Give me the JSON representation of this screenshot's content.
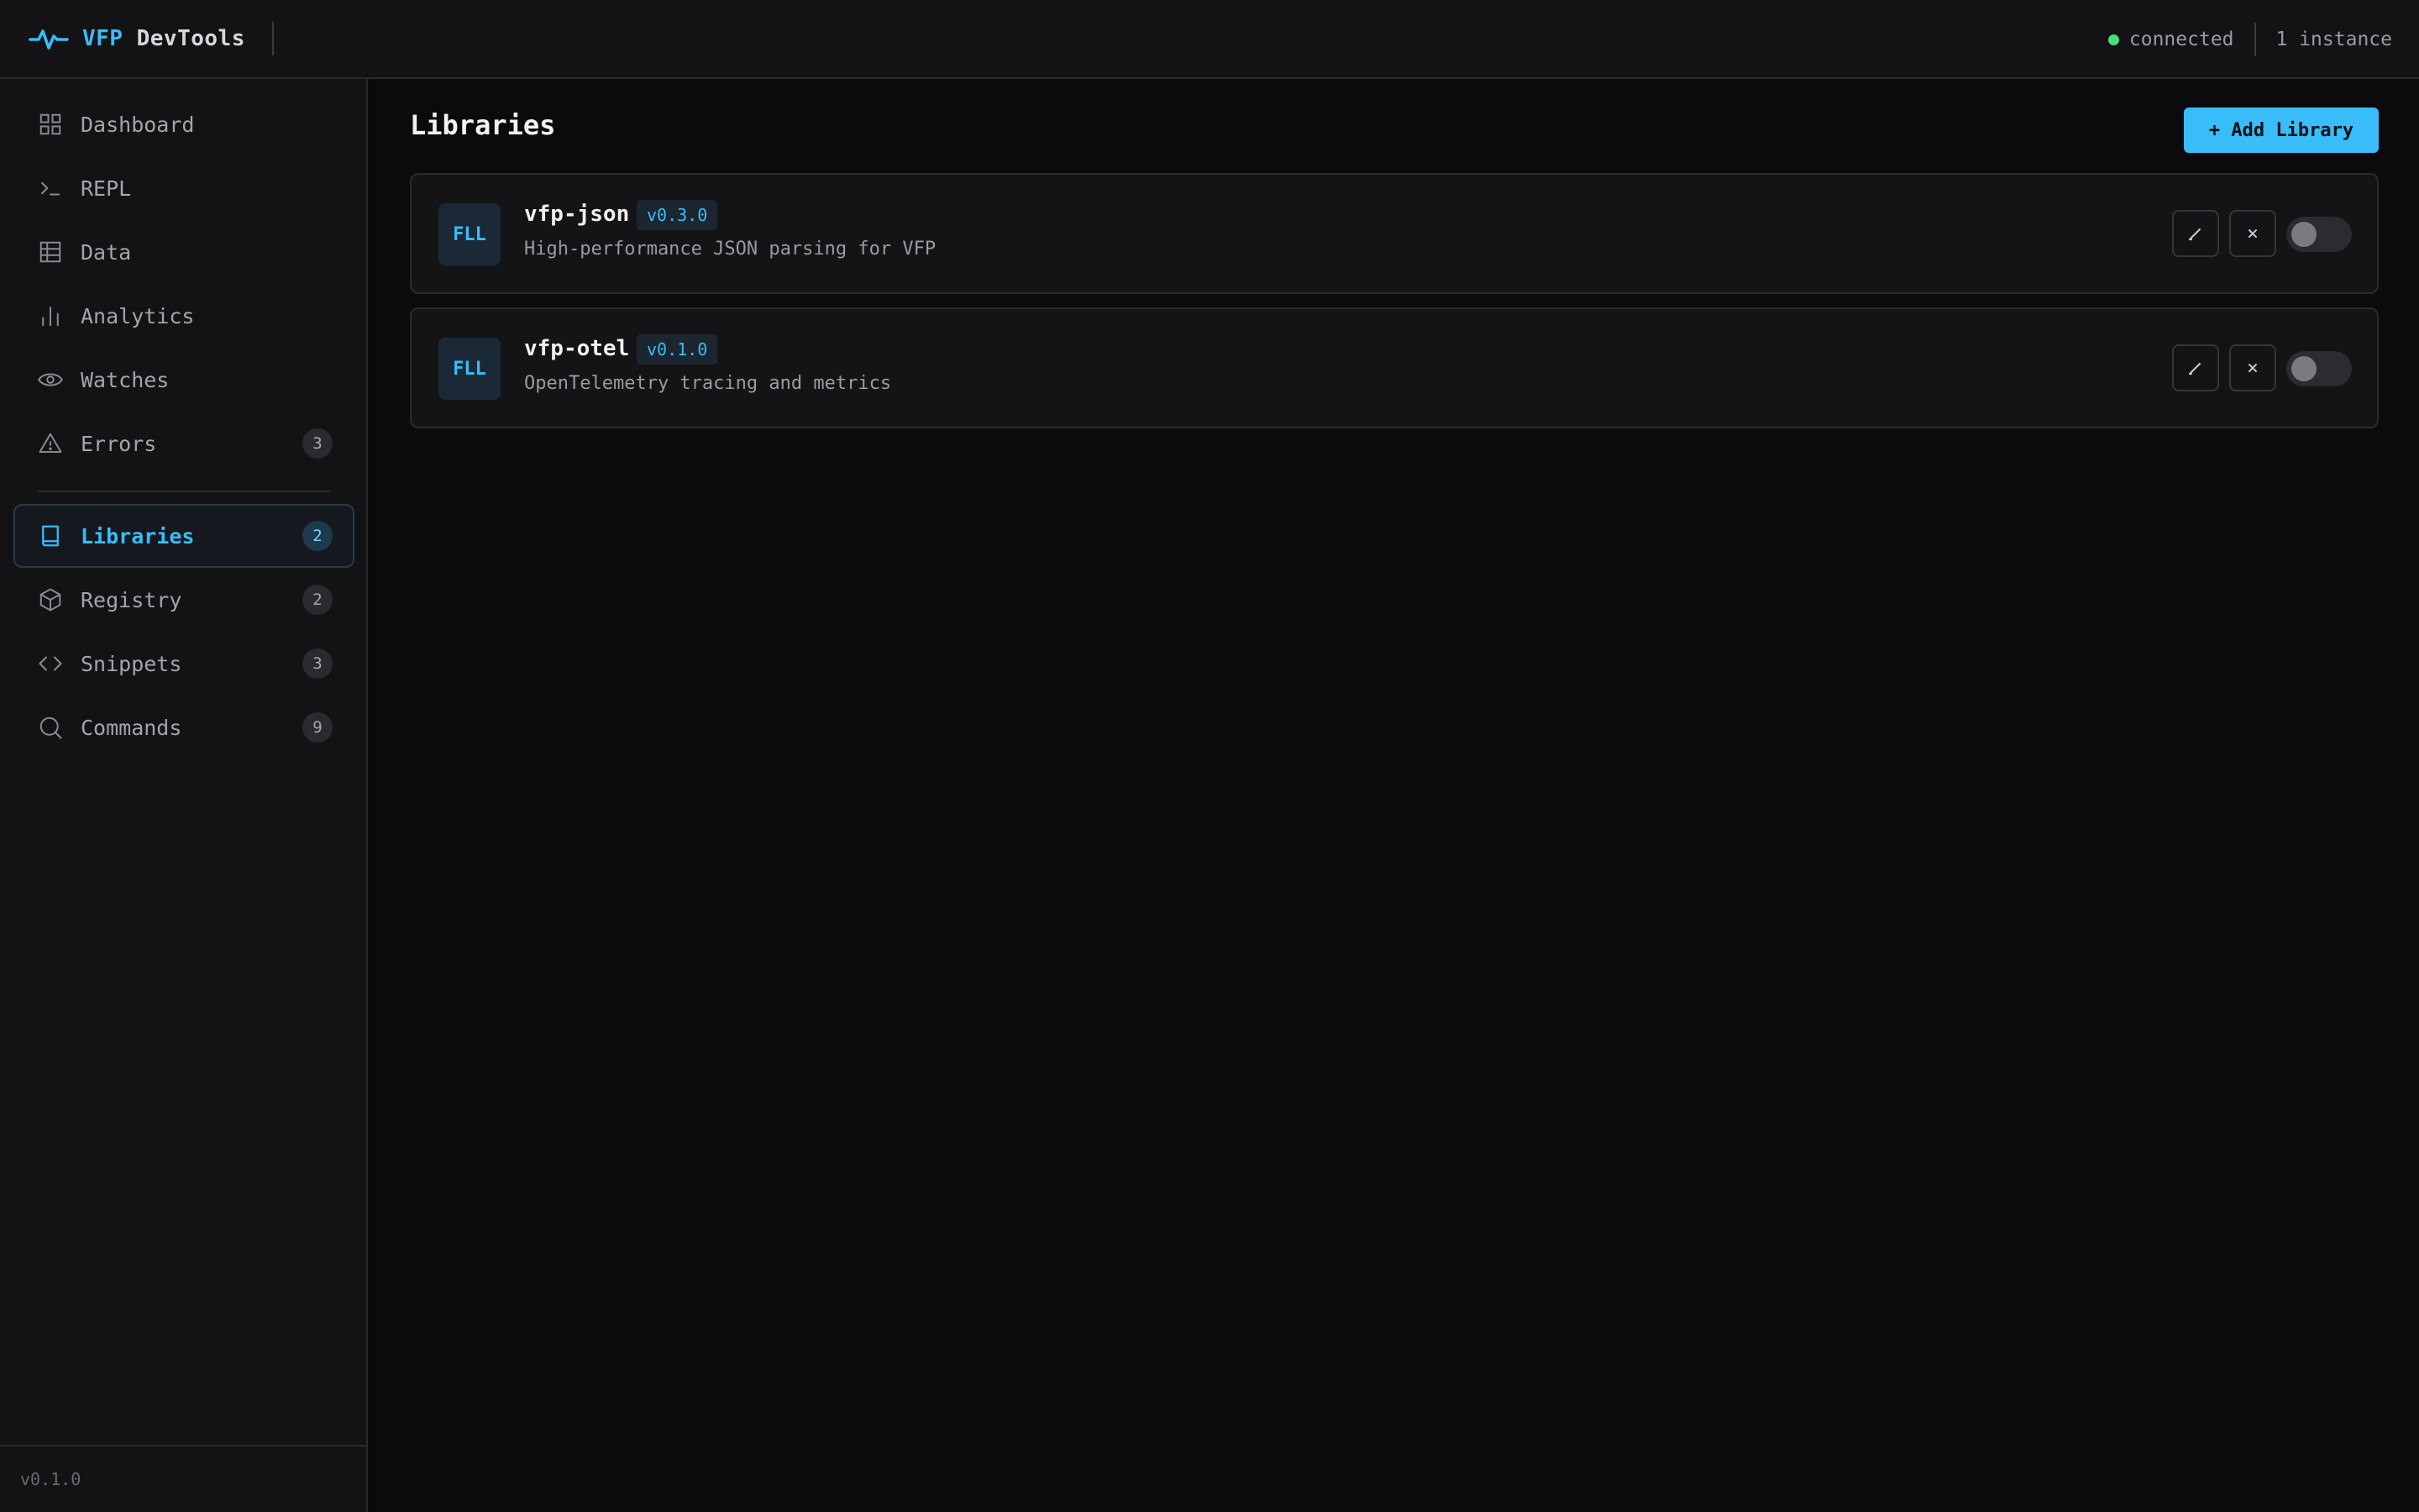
{
  "app": {
    "brand_accent": "VFP",
    "brand_rest": "DevTools",
    "connection_status": "connected",
    "instance_count": "1 instance",
    "version": "v0.1.0",
    "accent_color": "#38bdf8",
    "status_color": "#4ade80"
  },
  "sidebar": {
    "items": [
      {
        "label": "Dashboard",
        "icon": "grid-icon"
      },
      {
        "label": "REPL",
        "icon": "terminal-icon"
      },
      {
        "label": "Data",
        "icon": "table-icon"
      },
      {
        "label": "Analytics",
        "icon": "bar-chart-icon"
      },
      {
        "label": "Watches",
        "icon": "eye-icon"
      },
      {
        "label": "Errors",
        "icon": "warning-icon",
        "badge": "3"
      },
      {
        "label": "Libraries",
        "icon": "book-icon",
        "badge": "2",
        "active": true
      },
      {
        "label": "Registry",
        "icon": "package-icon",
        "badge": "2"
      },
      {
        "label": "Snippets",
        "icon": "code-icon",
        "badge": "3"
      },
      {
        "label": "Commands",
        "icon": "search-icon",
        "badge": "9"
      }
    ]
  },
  "main": {
    "title": "Libraries",
    "add_button": "+ Add Library",
    "libraries": [
      {
        "type": "FLL",
        "name": "vfp-json",
        "version": "v0.3.0",
        "description": "High-performance JSON parsing for VFP",
        "enabled": false
      },
      {
        "type": "FLL",
        "name": "vfp-otel",
        "version": "v0.1.0",
        "description": "OpenTelemetry tracing and metrics",
        "enabled": false
      }
    ]
  }
}
